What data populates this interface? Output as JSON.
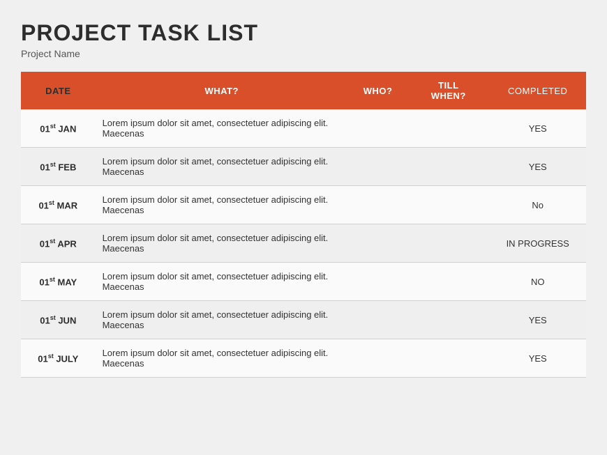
{
  "header": {
    "title": "PROJECT TASK LIST",
    "project_label": "Project Name"
  },
  "table": {
    "columns": [
      {
        "key": "date",
        "label": "DATE"
      },
      {
        "key": "what",
        "label": "WHAT?"
      },
      {
        "key": "who",
        "label": "WHO?"
      },
      {
        "key": "till_when",
        "label": "TILL\nWHEN?"
      },
      {
        "key": "completed",
        "label": "COMPLETED"
      }
    ],
    "rows": [
      {
        "date": "01st JAN",
        "date_day": "01",
        "date_sup": "st",
        "date_month": "JAN",
        "what": "Lorem ipsum dolor sit amet, consectetuer adipiscing elit. Maecenas",
        "who": "",
        "till_when": "",
        "completed": "YES"
      },
      {
        "date": "01st FEB",
        "date_day": "01",
        "date_sup": "st",
        "date_month": "FEB",
        "what": "Lorem ipsum dolor sit amet, consectetuer adipiscing elit. Maecenas",
        "who": "",
        "till_when": "",
        "completed": "YES"
      },
      {
        "date": "01st MAR",
        "date_day": "01",
        "date_sup": "st",
        "date_month": "MAR",
        "what": "Lorem ipsum dolor sit amet, consectetuer adipiscing elit. Maecenas",
        "who": "",
        "till_when": "",
        "completed": "No"
      },
      {
        "date": "01st APR",
        "date_day": "01",
        "date_sup": "st",
        "date_month": "APR",
        "what": "Lorem ipsum dolor sit amet, consectetuer adipiscing elit. Maecenas",
        "who": "",
        "till_when": "",
        "completed": "IN PROGRESS"
      },
      {
        "date": "01st MAY",
        "date_day": "01",
        "date_sup": "st",
        "date_month": "MAY",
        "what": "Lorem ipsum dolor sit amet, consectetuer adipiscing elit. Maecenas",
        "who": "",
        "till_when": "",
        "completed": "NO"
      },
      {
        "date": "01st JUN",
        "date_day": "01",
        "date_sup": "st",
        "date_month": "JUN",
        "what": "Lorem ipsum dolor sit amet, consectetuer adipiscing elit. Maecenas",
        "who": "",
        "till_when": "",
        "completed": "YES"
      },
      {
        "date": "01st JULY",
        "date_day": "01",
        "date_sup": "st",
        "date_month": "JULY",
        "what": "Lorem ipsum dolor sit amet, consectetuer adipiscing elit. Maecenas",
        "who": "",
        "till_when": "",
        "completed": "YES"
      }
    ]
  }
}
